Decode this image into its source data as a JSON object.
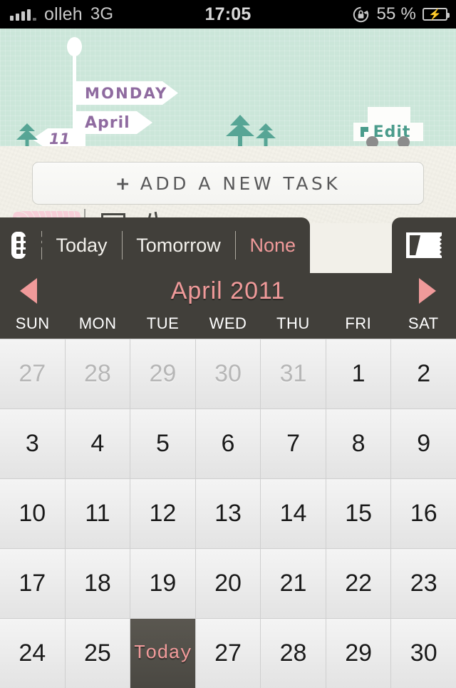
{
  "status_bar": {
    "carrier": "olleh",
    "network": "3G",
    "time": "17:05",
    "battery_percent": "55 %",
    "rotation_lock_icon": "rotation-lock-icon",
    "signal_icon": "signal-bars-icon",
    "battery_icon": "battery-charging-icon"
  },
  "header": {
    "weekday": "MONDAY",
    "month": "April",
    "day": "11",
    "edit_label": "Edit",
    "edit_icon": "truck-icon",
    "tree_icon": "pine-tree-icon",
    "signpost_icon": "signpost-icon",
    "background_color": "#cbe6d9",
    "sign_text_color": "#8f6ba0",
    "edit_text_color": "#4b9c8c"
  },
  "main": {
    "add_task_plus": "+",
    "add_task_label": "ADD A NEW TASK"
  },
  "date_toolbar": {
    "keyboard_icon": "keyboard-icon",
    "options": [
      "Today",
      "Tomorrow",
      "None"
    ],
    "none_color": "#f09a9a",
    "calendar_toggle_icon": "calendar-ticket-icon"
  },
  "calendar": {
    "title": "April 2011",
    "prev_icon": "left-triangle-icon",
    "next_icon": "right-triangle-icon",
    "title_color": "#f09a9a",
    "weekdays": [
      "SUN",
      "MON",
      "TUE",
      "WED",
      "THU",
      "FRI",
      "SAT"
    ],
    "today_label": "Today",
    "days": [
      {
        "label": "27",
        "state": "muted"
      },
      {
        "label": "28",
        "state": "muted"
      },
      {
        "label": "29",
        "state": "muted"
      },
      {
        "label": "30",
        "state": "muted"
      },
      {
        "label": "31",
        "state": "muted"
      },
      {
        "label": "1",
        "state": "current"
      },
      {
        "label": "2",
        "state": "current"
      },
      {
        "label": "3",
        "state": "current"
      },
      {
        "label": "4",
        "state": "current"
      },
      {
        "label": "5",
        "state": "current"
      },
      {
        "label": "6",
        "state": "current"
      },
      {
        "label": "7",
        "state": "current"
      },
      {
        "label": "8",
        "state": "current"
      },
      {
        "label": "9",
        "state": "current"
      },
      {
        "label": "10",
        "state": "current"
      },
      {
        "label": "11",
        "state": "current"
      },
      {
        "label": "12",
        "state": "current"
      },
      {
        "label": "13",
        "state": "current"
      },
      {
        "label": "14",
        "state": "current"
      },
      {
        "label": "15",
        "state": "current"
      },
      {
        "label": "16",
        "state": "current"
      },
      {
        "label": "17",
        "state": "current"
      },
      {
        "label": "18",
        "state": "current"
      },
      {
        "label": "19",
        "state": "current"
      },
      {
        "label": "20",
        "state": "current"
      },
      {
        "label": "21",
        "state": "current"
      },
      {
        "label": "22",
        "state": "current"
      },
      {
        "label": "23",
        "state": "current"
      },
      {
        "label": "24",
        "state": "current"
      },
      {
        "label": "25",
        "state": "current"
      },
      {
        "label": "Today",
        "state": "today"
      },
      {
        "label": "27",
        "state": "current"
      },
      {
        "label": "28",
        "state": "current"
      },
      {
        "label": "29",
        "state": "current"
      },
      {
        "label": "30",
        "state": "current"
      }
    ]
  }
}
